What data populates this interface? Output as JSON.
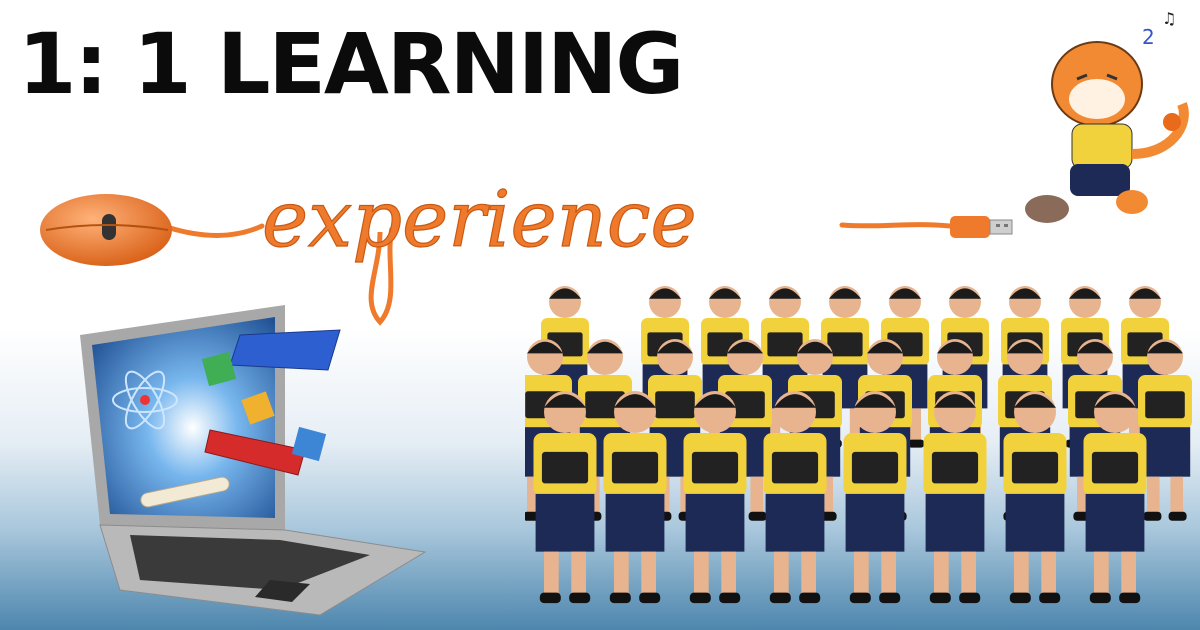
{
  "headline": "1: 1 LEARNING",
  "cursive_word": "experience",
  "colors": {
    "headline": "#0b0b0b",
    "cable_orange": "#f07a2b",
    "laptop_screen": "#2e6fb8",
    "uniform_yellow": "#f2d23c",
    "uniform_navy": "#1d2a55",
    "bg_bottom": "#4d86ad"
  },
  "icons": [
    "computer-mouse-icon",
    "usb-plug-icon",
    "laptop-icon",
    "tiger-mascot-icon",
    "book-icon",
    "alphabet-block-icon",
    "atom-icon",
    "diploma-scroll-icon"
  ]
}
